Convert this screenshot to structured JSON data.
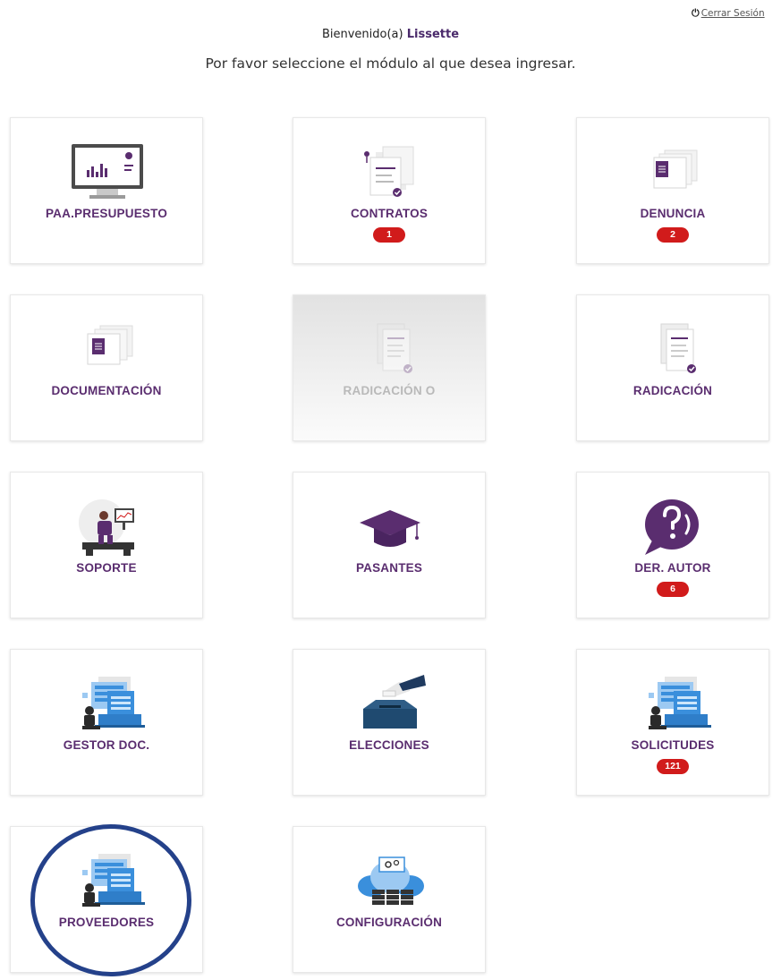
{
  "header": {
    "logout_label": "Cerrar Sesión",
    "logout_icon": "power-icon",
    "welcome_prefix": "Bienvenido(a) ",
    "user_name": "Lissette",
    "instruction": "Por favor seleccione el módulo al que desea ingresar."
  },
  "modules": [
    {
      "label": "PAA.PRESUPUESTO",
      "icon": "monitor-chart-icon",
      "badge": null,
      "enabled": true
    },
    {
      "label": "CONTRATOS",
      "icon": "contract-documents-icon",
      "badge": "1",
      "enabled": true
    },
    {
      "label": "DENUNCIA",
      "icon": "document-stack-icon",
      "badge": "2",
      "enabled": true
    },
    {
      "label": "DOCUMENTACIÓN",
      "icon": "document-stack-icon",
      "badge": null,
      "enabled": true
    },
    {
      "label": "RADICACIÓN O",
      "icon": "document-check-icon",
      "badge": null,
      "enabled": false
    },
    {
      "label": "RADICACIÓN",
      "icon": "document-check-icon",
      "badge": null,
      "enabled": true
    },
    {
      "label": "SOPORTE",
      "icon": "support-desk-icon",
      "badge": null,
      "enabled": true
    },
    {
      "label": "PASANTES",
      "icon": "graduation-cap-icon",
      "badge": null,
      "enabled": true
    },
    {
      "label": "DER. AUTOR",
      "icon": "question-bubble-icon",
      "badge": "6",
      "enabled": true
    },
    {
      "label": "GESTOR DOC.",
      "icon": "person-laptop-screens-icon",
      "badge": null,
      "enabled": true
    },
    {
      "label": "ELECCIONES",
      "icon": "ballot-box-icon",
      "badge": null,
      "enabled": true
    },
    {
      "label": "SOLICITUDES",
      "icon": "person-laptop-screens-icon",
      "badge": "121",
      "enabled": true
    },
    {
      "label": "PROVEEDORES",
      "icon": "person-laptop-screens-icon",
      "badge": null,
      "enabled": true
    },
    {
      "label": "CONFIGURACIÓN",
      "icon": "cloud-servers-icon",
      "badge": null,
      "enabled": true
    }
  ],
  "colors": {
    "brand_purple": "#5a2d6f",
    "badge_red": "#d11b1b",
    "highlight_circle": "#24418a",
    "icon_blue": "#3a8fdc"
  }
}
